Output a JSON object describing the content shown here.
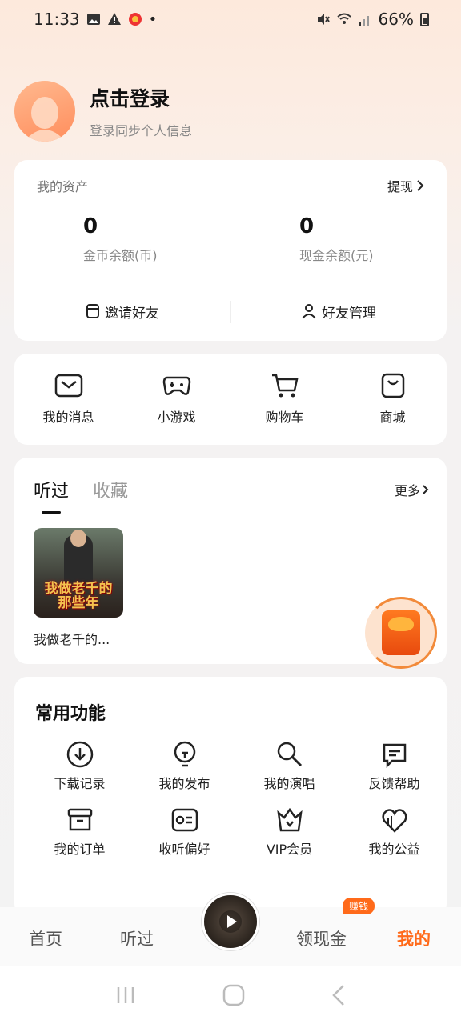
{
  "status_bar": {
    "time": "11:33",
    "battery": "66%"
  },
  "profile": {
    "title": "点击登录",
    "subtitle": "登录同步个人信息"
  },
  "assets": {
    "label": "我的资产",
    "withdraw": "提现",
    "coin_value": "0",
    "coin_label": "金币余额(币)",
    "cash_value": "0",
    "cash_label": "现金余额(元)",
    "invite": "邀请好友",
    "manage": "好友管理"
  },
  "shortcuts": {
    "messages": "我的消息",
    "games": "小游戏",
    "cart": "购物车",
    "mall": "商城"
  },
  "history": {
    "tab_listened": "听过",
    "tab_favorites": "收藏",
    "more": "更多",
    "book_title": "我做老千的...",
    "cover_text": "我做老千的那些年"
  },
  "functions": {
    "title": "常用功能",
    "download": "下载记录",
    "publish": "我的发布",
    "sing": "我的演唱",
    "feedback": "反馈帮助",
    "orders": "我的订单",
    "preference": "收听偏好",
    "vip": "VIP会员",
    "charity": "我的公益"
  },
  "nav": {
    "home": "首页",
    "listened": "听过",
    "cash": "领现金",
    "badge": "赚钱",
    "mine": "我的"
  },
  "colors": {
    "accent": "#ff6a1a"
  }
}
